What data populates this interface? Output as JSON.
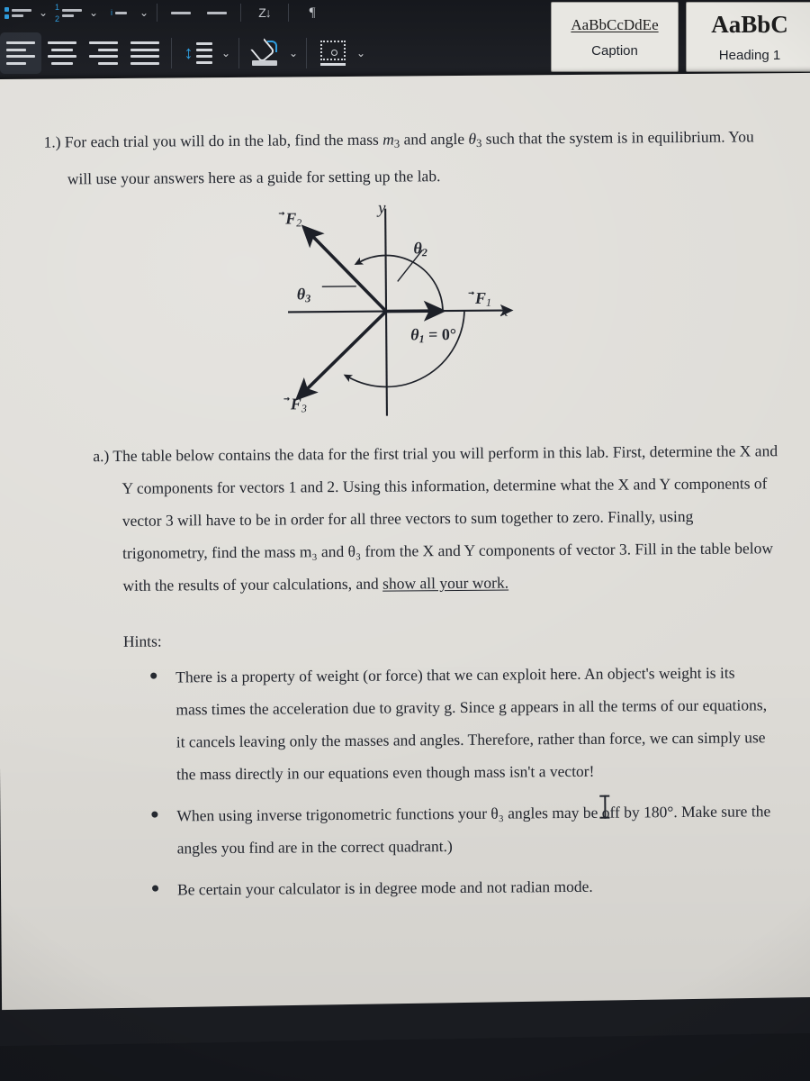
{
  "app": {
    "name": "Microsoft Word",
    "theme": "dark"
  },
  "ribbon": {
    "paragraph_group": {
      "top_row_icons": [
        {
          "name": "bullets-icon",
          "label": "Bullets"
        },
        {
          "name": "numbering-icon",
          "label": "Numbering"
        },
        {
          "name": "multilevel-list-icon",
          "label": "Multilevel List"
        },
        {
          "name": "decrease-indent-icon",
          "label": "Decrease Indent"
        },
        {
          "name": "increase-indent-icon",
          "label": "Increase Indent"
        },
        {
          "name": "sort-icon",
          "label": "Z↓"
        },
        {
          "name": "show-formatting-marks-icon",
          "label": "¶"
        }
      ],
      "bottom_row_icons": [
        {
          "name": "align-left-icon",
          "label": "Align Left",
          "active": true
        },
        {
          "name": "align-center-icon",
          "label": "Center",
          "active": false
        },
        {
          "name": "align-right-icon",
          "label": "Align Right",
          "active": false
        },
        {
          "name": "justify-icon",
          "label": "Justify",
          "active": false
        },
        {
          "name": "line-spacing-icon",
          "label": "Line and Paragraph Spacing"
        },
        {
          "name": "shading-icon",
          "label": "Shading"
        },
        {
          "name": "borders-icon",
          "label": "Borders"
        }
      ],
      "chevron": "⌄"
    },
    "styles_gallery": [
      {
        "sample": "AaBbCcDdEe",
        "label": "Caption",
        "style_kind": "caption"
      },
      {
        "sample": "AaBbC",
        "label": "Heading 1",
        "style_kind": "h1"
      }
    ]
  },
  "document": {
    "q1": {
      "marker": "1.)",
      "line1_a": "For each trial you will do in the lab, find the mass ",
      "m3": "m",
      "m3_sub": "3",
      "line1_b": " and angle ",
      "theta3": "θ",
      "theta3_sub": "3",
      "line1_c": " such that the system",
      "line2": "is in equilibrium.  You will use your answers here as a guide for setting up the lab."
    },
    "diagram": {
      "axis_x_label": "x",
      "axis_y_label": "y",
      "vectors": [
        {
          "name": "F1",
          "label": "F",
          "sub": "1",
          "angle_deg": 0,
          "length": 0.52,
          "desc": "along +x axis"
        },
        {
          "name": "F2",
          "label": "F",
          "sub": "2",
          "angle_deg": 135,
          "length": 0.78,
          "desc": "upper-left quadrant"
        },
        {
          "name": "F3",
          "label": "F",
          "sub": "3",
          "angle_deg": 245,
          "length": 0.8,
          "desc": "lower-left quadrant"
        }
      ],
      "angle_labels": [
        {
          "name": "theta1",
          "text": "θ",
          "sub": "1",
          "value": "= 0°"
        },
        {
          "name": "theta2",
          "text": "θ",
          "sub": "2",
          "value": ""
        },
        {
          "name": "theta3",
          "text": "θ",
          "sub": "3",
          "value": ""
        }
      ]
    },
    "part_a": {
      "marker": "a.)",
      "lines": [
        "The table below contains the data for the first trial you will perform in this lab.",
        "First, determine the X and Y components for vectors 1 and 2.  Using this",
        "information, determine what the X and Y components of vector 3 will have to",
        "be in order for all three vectors to sum together to zero.  Finally, using",
        "trigonometry, find the mass m₃ and θ₃ from the X and Y components of",
        "vector 3.  Fill in the table below with the results of your calculations, and"
      ],
      "underlined_tail": "show all your work."
    },
    "hints": {
      "heading": "Hints:",
      "items": [
        "There is a property of weight (or force) that we can exploit here.  An object's weight is its mass times the acceleration due to gravity g.  Since g appears in all the terms of our equations, it cancels leaving only the masses and angles.  Therefore, rather than force, we can simply use the mass directly in our equations even though mass isn't a vector!",
        "When using inverse trigonometric functions your θ₃ angles may be off by 180°.  Make sure the angles you find are in the correct quadrant.)",
        "Be certain your calculator is in degree mode and not radian mode."
      ]
    }
  },
  "cursor": {
    "name": "text-i-beam-cursor",
    "over_word": "exploit"
  },
  "colors": {
    "ribbon_bg": "#1a1c21",
    "page_bg": "#dedcd7",
    "text": "#23262e",
    "accent_blue": "#2f9ee0",
    "style_card_bg": "#e8e7e2"
  }
}
